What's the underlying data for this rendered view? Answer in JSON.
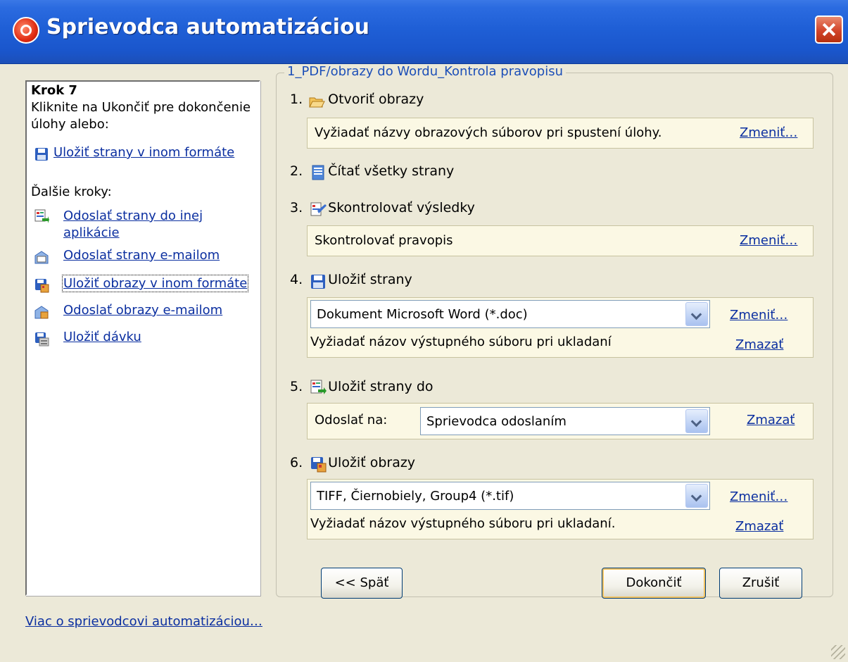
{
  "window": {
    "title": "Sprievodca automatizáciou"
  },
  "left_panel": {
    "heading": "Krok 7",
    "instruction_line1": "Kliknite na Ukončiť pre dokončenie",
    "instruction_line2": "úlohy alebo:",
    "primary_link": "Uložiť strany v inom formáte",
    "next_steps_label": "Ďalšie kroky:",
    "links": [
      {
        "label_line1": "Odoslať strany do inej",
        "label_line2": "aplikácie",
        "icon": "send-to-app-icon"
      },
      {
        "label_line1": "Odoslať strany e-mailom",
        "icon": "email-pages-icon"
      },
      {
        "label_line1": "Uložiť obrazy v inom formáte",
        "icon": "save-images-icon"
      },
      {
        "label_line1": "Odoslať obrazy e-mailom",
        "icon": "email-images-icon"
      },
      {
        "label_line1": "Uložiť dávku",
        "icon": "save-batch-icon"
      }
    ]
  },
  "task": {
    "caption": "1_PDF/obrazy do Wordu_Kontrola pravopisu",
    "steps": [
      {
        "num": "1.",
        "label": "Otvoriť obrazy",
        "icon": "open-folder-icon",
        "info": "Vyžiadať názvy obrazových súborov pri spustení úlohy.",
        "change": "Zmeniť…"
      },
      {
        "num": "2.",
        "label": "Čítať všetky strany",
        "icon": "read-pages-icon"
      },
      {
        "num": "3.",
        "label": "Skontrolovať výsledky",
        "icon": "check-results-icon",
        "info": "Skontrolovať pravopis",
        "change": "Zmeniť…"
      },
      {
        "num": "4.",
        "label": "Uložiť strany",
        "icon": "floppy-icon",
        "format": "Dokument Microsoft Word (*.doc)",
        "change": "Zmeniť…",
        "info": "Vyžiadať názov výstupného súboru pri ukladaní",
        "delete": "Zmazať"
      },
      {
        "num": "5.",
        "label": "Uložiť strany do",
        "icon": "send-to-app-icon",
        "send_label": "Odoslať na:",
        "target": "Sprievodca odoslaním",
        "delete": "Zmazať"
      },
      {
        "num": "6.",
        "label": "Uložiť obrazy",
        "icon": "save-images-icon",
        "format": "TIFF, Čiernobiely, Group4 (*.tif)",
        "change": "Zmeniť…",
        "info": "Vyžiadať názov výstupného súboru pri ukladaní.",
        "delete": "Zmazať"
      }
    ]
  },
  "footer": {
    "more_link": "Viac o sprievodcovi automatizáciou…",
    "back_button": "<< Späť",
    "finish_button": "Dokončiť",
    "cancel_button": "Zrušiť"
  }
}
